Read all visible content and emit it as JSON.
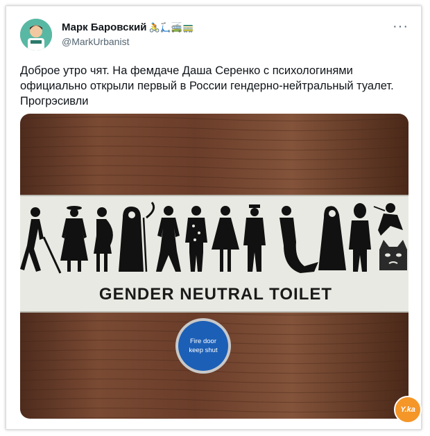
{
  "tweet": {
    "author_name": "Марк Баровский",
    "author_emoji": "🚴🛴🚎🚃",
    "handle": "@MarkUrbanist",
    "more_icon": "more-dots-icon",
    "text": "Доброе утро чят. На фемдаче Даша Серенко с психологинями\nофициально открыли первый в России гендерно-нейтральный туалет.\nПрогрэсивли"
  },
  "photo": {
    "sign_text": "GENDER NEUTRAL TOILET",
    "fire_door_line1": "Fire door",
    "fire_door_line2": "keep shut"
  },
  "watermark": {
    "label": "Y.ka"
  },
  "colors": {
    "wood": "#6b3f2c",
    "sign": "#e8e8e2",
    "fire_door": "#1c5fb6"
  }
}
